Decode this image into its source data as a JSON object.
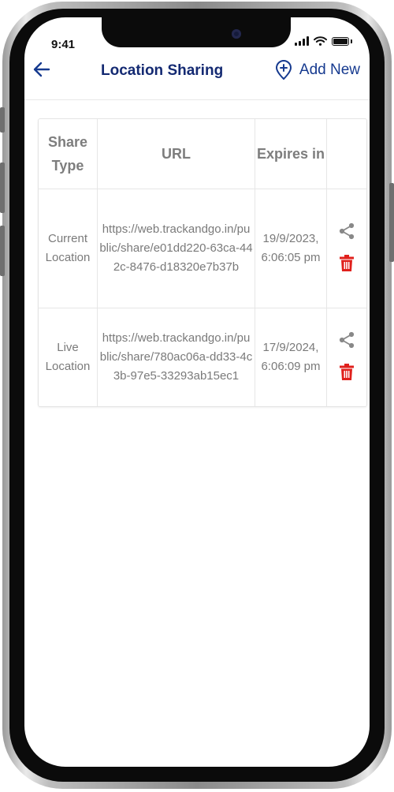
{
  "status_bar": {
    "time": "9:41"
  },
  "header": {
    "title": "Location Sharing",
    "add_new_label": "Add New"
  },
  "table": {
    "headers": {
      "share_type": "Share Type",
      "url": "URL",
      "expires_in": "Expires in"
    },
    "rows": [
      {
        "share_type": "Current Location",
        "url": "https://web.trackandgo.in/public/share/e01dd220-63ca-442c-8476-d18320e7b37b",
        "expires": "19/9/2023, 6:06:05 pm"
      },
      {
        "share_type": "Live Location",
        "url": "https://web.trackandgo.in/public/share/780ac06a-dd33-4c3b-97e5-33293ab15ec1",
        "expires": "17/9/2024, 6:06:09 pm"
      }
    ]
  },
  "colors": {
    "brand_navy": "#142a72",
    "icon_blue": "#163a8f",
    "delete_red": "#e0201c",
    "share_gray": "#888888"
  },
  "icons": [
    "back-arrow-icon",
    "add-location-icon",
    "share-icon",
    "trash-icon",
    "wifi-icon",
    "battery-icon",
    "signal-icon"
  ]
}
